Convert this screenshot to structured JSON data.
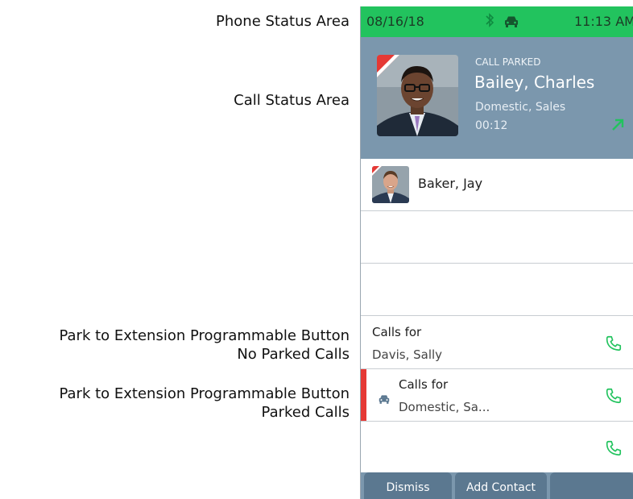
{
  "callouts": {
    "phone_status": "Phone Status Area",
    "call_status": "Call Status Area",
    "park_no_calls_line1": "Park to Extension Programmable Button",
    "park_no_calls_line2": "No Parked Calls",
    "park_calls_line1": "Park to Extension Programmable Button",
    "park_calls_line2": "Parked Calls"
  },
  "status_bar": {
    "date": "08/16/18",
    "time": "11:13 AM",
    "icons": [
      "bluetooth-icon",
      "car-icon"
    ],
    "color": "#22c35e"
  },
  "call_status": {
    "label": "CALL PARKED",
    "name": "Bailey, Charles",
    "department": "Domestic, Sales",
    "duration": "00:12",
    "background": "#7b97ad"
  },
  "contacts": [
    {
      "name": "Baker, Jay"
    }
  ],
  "park_buttons": [
    {
      "title": "Calls for",
      "subtitle": "Davis, Sally",
      "parked": false
    },
    {
      "title": "Calls for",
      "subtitle": "Domestic, Sa...",
      "parked": true
    }
  ],
  "softkeys": {
    "dismiss": "Dismiss",
    "add_contact": "Add Contact"
  },
  "colors": {
    "accent_green": "#22c35e",
    "parked_red": "#e53935"
  }
}
